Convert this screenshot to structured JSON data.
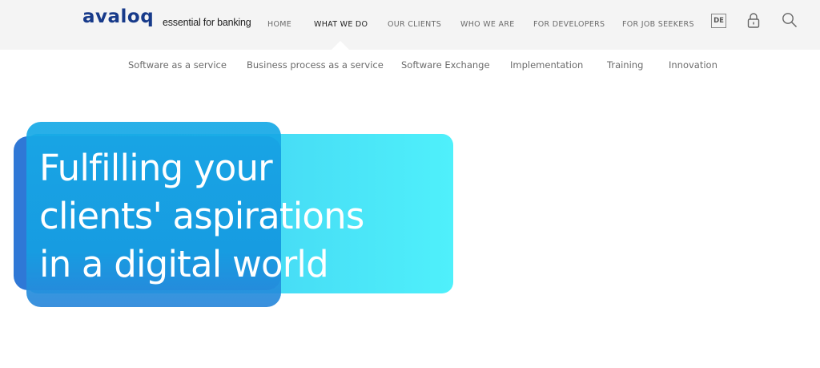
{
  "header": {
    "logo": "avaloq",
    "tagline": "essential for banking",
    "nav": [
      {
        "label": "HOME",
        "active": false
      },
      {
        "label": "WHAT WE DO",
        "active": true
      },
      {
        "label": "OUR CLIENTS",
        "active": false
      },
      {
        "label": "WHO WE ARE",
        "active": false
      },
      {
        "label": "FOR DEVELOPERS",
        "active": false
      },
      {
        "label": "FOR JOB SEEKERS",
        "active": false
      }
    ],
    "language": "DE",
    "icons": {
      "login": "lock-icon",
      "search": "search-icon"
    }
  },
  "subnav": [
    "Software as a service",
    "Business process as a service",
    "Software Exchange",
    "Implementation",
    "Training",
    "Innovation"
  ],
  "hero": {
    "title_lines": [
      "Fulfilling your",
      "clients' aspirations",
      "in a digital world"
    ]
  },
  "colors": {
    "brand": "#173a8a",
    "hero_dark": "#2f78d6",
    "hero_mid": "#16a9e6",
    "hero_light": "#4ff0fb"
  }
}
